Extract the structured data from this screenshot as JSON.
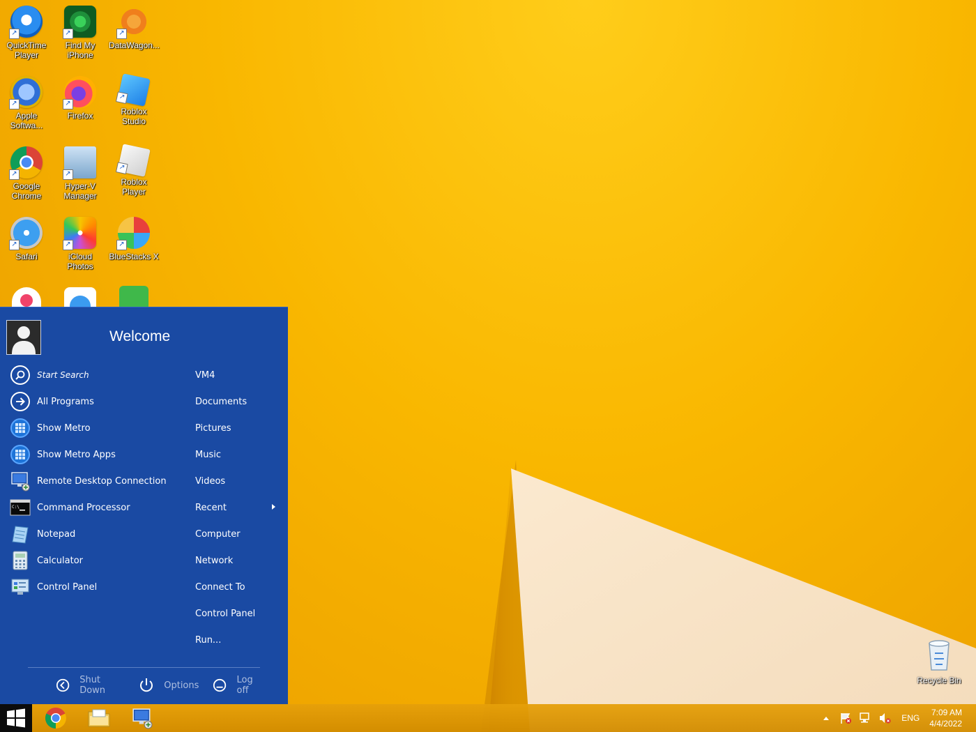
{
  "desktop": {
    "icons": [
      {
        "label": "QuickTime Player",
        "icon": "quicktime-icon"
      },
      {
        "label": "Find My iPhone",
        "icon": "find-my-iphone-icon"
      },
      {
        "label": "DataWagon...",
        "icon": "datawagon-icon"
      },
      {
        "label": "Apple Softwa...",
        "icon": "apple-software-update-icon"
      },
      {
        "label": "Firefox",
        "icon": "firefox-icon"
      },
      {
        "label": "Roblox Studio",
        "icon": "roblox-studio-icon"
      },
      {
        "label": "Google Chrome",
        "icon": "chrome-icon"
      },
      {
        "label": "Hyper-V Manager",
        "icon": "hyper-v-icon"
      },
      {
        "label": "Roblox Player",
        "icon": "roblox-player-icon"
      },
      {
        "label": "Safari",
        "icon": "safari-icon"
      },
      {
        "label": "iCloud Photos",
        "icon": "icloud-photos-icon"
      },
      {
        "label": "BlueStacks X",
        "icon": "bluestacks-icon"
      }
    ],
    "recycle_bin": "Recycle Bin"
  },
  "start_menu": {
    "welcome": "Welcome",
    "left_items": [
      {
        "label": "Start Search",
        "icon": "search-icon"
      },
      {
        "label": "All Programs",
        "icon": "arrow-right-icon"
      },
      {
        "label": "Show Metro",
        "icon": "metro-icon"
      },
      {
        "label": "Show Metro Apps",
        "icon": "metro-apps-icon"
      },
      {
        "label": "Remote Desktop Connection",
        "icon": "remote-desktop-icon"
      },
      {
        "label": "Command Processor",
        "icon": "command-prompt-icon"
      },
      {
        "label": "Notepad",
        "icon": "notepad-icon"
      },
      {
        "label": "Calculator",
        "icon": "calculator-icon"
      },
      {
        "label": "Control Panel",
        "icon": "control-panel-icon"
      }
    ],
    "right_items": [
      {
        "label": "VM4"
      },
      {
        "label": "Documents"
      },
      {
        "label": "Pictures"
      },
      {
        "label": "Music"
      },
      {
        "label": "Videos"
      },
      {
        "label": "Recent"
      },
      {
        "label": "Computer"
      },
      {
        "label": "Network"
      },
      {
        "label": "Connect To"
      },
      {
        "label": "Control Panel"
      },
      {
        "label": "Run..."
      }
    ],
    "bottom": {
      "shutdown": "Shut Down",
      "options": "Options",
      "logoff": "Log off"
    }
  },
  "taskbar": {
    "apps": [
      "chrome-icon",
      "file-explorer-icon",
      "remote-desktop-icon"
    ],
    "language": "ENG",
    "time": "7:09 AM",
    "date": "4/4/2022"
  }
}
